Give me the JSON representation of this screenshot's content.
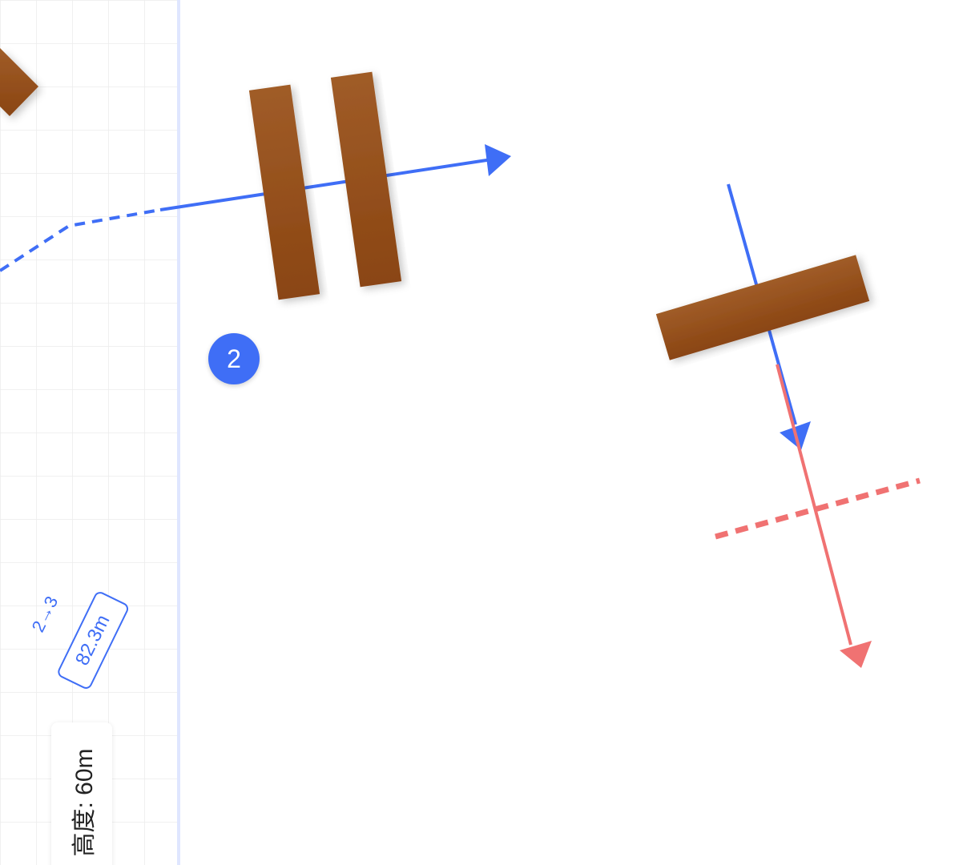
{
  "map": {
    "colors": {
      "background": "#ffffff",
      "grid": "#ececec",
      "panel_divider": "#dfe6ff",
      "path_blue": "#3f6ef6",
      "path_red": "#f07272",
      "obstacle_dark": "#8a4512",
      "obstacle_light": "#a05c28"
    },
    "waypoint_badge": {
      "number": "2"
    },
    "segment_label": {
      "route": "2→3",
      "distance": "82.3m"
    },
    "altitude": {
      "text": "高度: 60m"
    }
  }
}
